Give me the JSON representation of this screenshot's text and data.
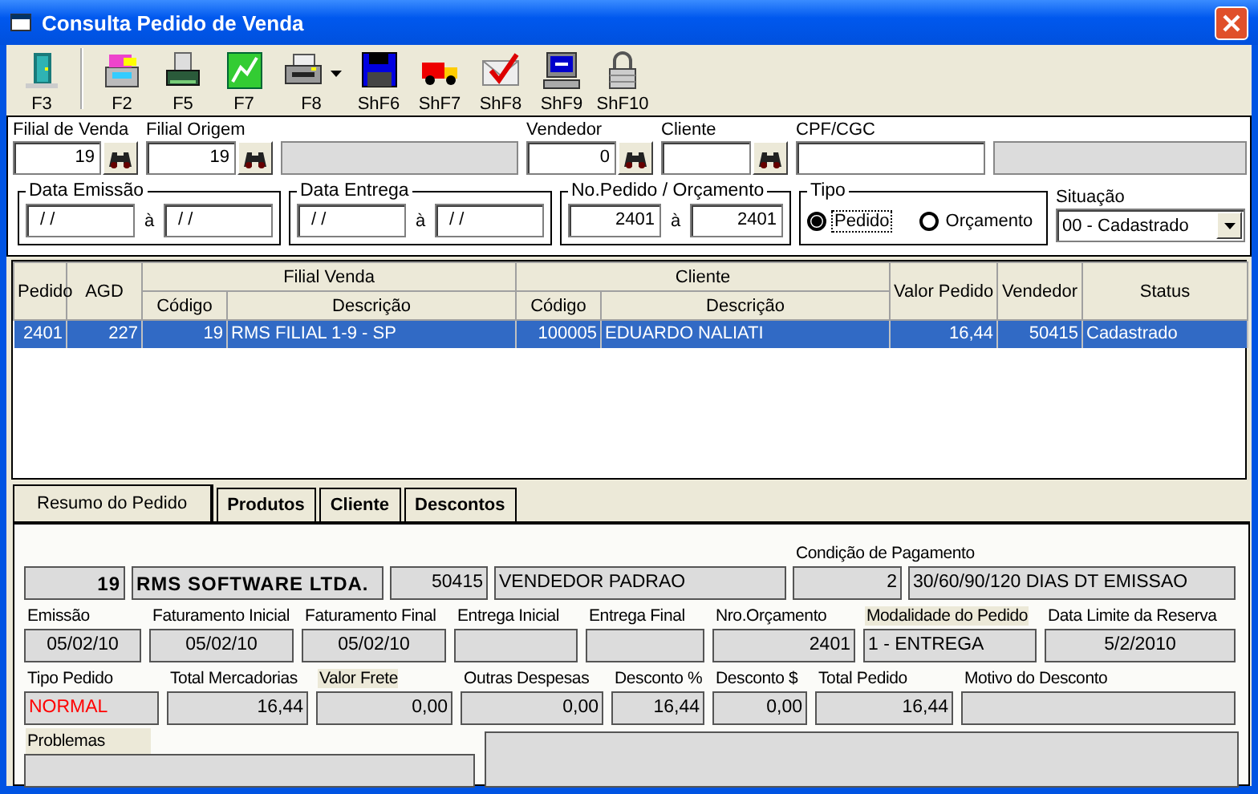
{
  "window": {
    "title": "Consulta Pedido de Venda"
  },
  "toolbar": [
    [
      {
        "label": "F3",
        "dropdown": false
      }
    ],
    [
      {
        "label": "F2",
        "dropdown": false
      },
      {
        "label": "F5",
        "dropdown": false
      },
      {
        "label": "F7",
        "dropdown": false
      },
      {
        "label": "F8",
        "dropdown": true
      },
      {
        "label": "ShF6",
        "dropdown": false
      },
      {
        "label": "ShF7",
        "dropdown": false
      },
      {
        "label": "ShF8",
        "dropdown": false
      },
      {
        "label": "ShF9",
        "dropdown": false
      },
      {
        "label": "ShF10",
        "dropdown": false
      }
    ]
  ],
  "filters": [
    {
      "kind": "input",
      "label": "Filial de Venda",
      "value": "19",
      "lookup": true
    },
    {
      "kind": "input",
      "label": "Filial Origem",
      "value": "19",
      "lookup": true
    },
    {
      "kind": "display",
      "lookup": false
    },
    {
      "kind": "input",
      "label": "Vendedor",
      "value": "0",
      "lookup": true
    },
    {
      "kind": "input",
      "label": "Cliente",
      "lookup": true
    },
    {
      "kind": "input",
      "label": "CPF/CGC",
      "lookup": false
    },
    {
      "kind": "display",
      "lookup": false
    }
  ],
  "ranges": [
    {
      "label": "Data Emissão",
      "from": "/ /",
      "separator": "à",
      "to": "/ /",
      "kind": "date"
    },
    {
      "label": "Data Entrega",
      "from": "/ /",
      "separator": "à",
      "to": "/ /",
      "kind": "date"
    },
    {
      "label": "No.Pedido / Orçamento",
      "from": "2401",
      "separator": "à",
      "to": "2401",
      "kind": "number"
    }
  ],
  "tipo": {
    "label": "Tipo",
    "options": [
      {
        "label": "Pedido",
        "selected": true
      },
      {
        "label": "Orçamento",
        "selected": false
      }
    ]
  },
  "situacao": {
    "label": "Situação",
    "value": "00 - Cadastrado"
  },
  "orders_table": {
    "header": [
      {
        "label": "Pedido"
      },
      {
        "label": "AGD"
      },
      {
        "label": "Filial Venda",
        "sub": [
          "Código",
          "Descrição"
        ]
      },
      {
        "label": "Cliente",
        "sub": [
          "Código",
          "Descrição"
        ]
      },
      {
        "label": "Valor Pedido"
      },
      {
        "label": "Vendedor"
      },
      {
        "label": "Status"
      }
    ],
    "rows": [
      {
        "selected": true,
        "cells": [
          "2401",
          "227",
          "19",
          "RMS FILIAL 1-9 - SP",
          "100005",
          "EDUARDO NALIATI",
          "16,44",
          "50415",
          "Cadastrado"
        ]
      }
    ]
  },
  "tabs": [
    {
      "label": "Resumo do Pedido",
      "selected": true
    },
    {
      "label": "Produtos",
      "selected": false
    },
    {
      "label": "Cliente",
      "selected": false
    },
    {
      "label": "Descontos",
      "selected": false
    }
  ],
  "summary": {
    "header_fields": [
      {
        "value": "19",
        "kind": "number",
        "bold": true
      },
      {
        "value": "RMS SOFTWARE LTDA.",
        "kind": "text",
        "bold": true
      },
      {
        "value": "50415",
        "kind": "number",
        "bold": false
      },
      {
        "value": "VENDEDOR PADRAO",
        "kind": "text",
        "bold": false
      },
      {
        "label": "Condição de Pagamento",
        "value": "2",
        "kind": "number",
        "bold": false
      },
      {
        "value": "30/60/90/120 DIAS DT EMISSAO",
        "kind": "text",
        "bold": false
      }
    ],
    "dates": [
      {
        "label": "Emissão",
        "value": "05/02/10",
        "kind": "date",
        "label_shaded": false
      },
      {
        "label": "Faturamento Inicial",
        "value": "05/02/10",
        "kind": "date",
        "label_shaded": false
      },
      {
        "label": "Faturamento Final",
        "value": "05/02/10",
        "kind": "date",
        "label_shaded": false
      },
      {
        "label": "Entrega Inicial",
        "kind": "date",
        "label_shaded": false
      },
      {
        "label": "Entrega Final",
        "kind": "date",
        "label_shaded": false
      },
      {
        "label": "Nro.Orçamento",
        "value": "2401",
        "kind": "number",
        "label_shaded": false
      },
      {
        "label": "Modalidade do Pedido",
        "value": "1 - ENTREGA",
        "kind": "text",
        "label_shaded": true
      },
      {
        "label": "Data Limite da Reserva",
        "value": "5/2/2010",
        "kind": "date",
        "label_shaded": false
      }
    ],
    "totals": [
      {
        "label": "Tipo Pedido",
        "value": "NORMAL",
        "kind": "text",
        "color": "#ff0000",
        "label_shaded": false
      },
      {
        "label": "Total Mercadorias",
        "value": "16,44",
        "kind": "number",
        "label_shaded": false
      },
      {
        "label": "Valor Frete",
        "value": "0,00",
        "kind": "number",
        "label_shaded": true
      },
      {
        "label": "Outras Despesas",
        "value": "0,00",
        "kind": "number",
        "label_shaded": false
      },
      {
        "label": "Desconto %",
        "value": "16,44",
        "kind": "number",
        "label_shaded": false
      },
      {
        "label": "Desconto $",
        "value": "0,00",
        "kind": "number",
        "label_shaded": false
      },
      {
        "label": "Total Pedido",
        "value": "16,44",
        "kind": "number",
        "label_shaded": false
      },
      {
        "label": "Motivo do Desconto",
        "kind": "text",
        "label_shaded": false
      }
    ],
    "problems": {
      "label": "Problemas",
      "label_shaded": true
    }
  }
}
